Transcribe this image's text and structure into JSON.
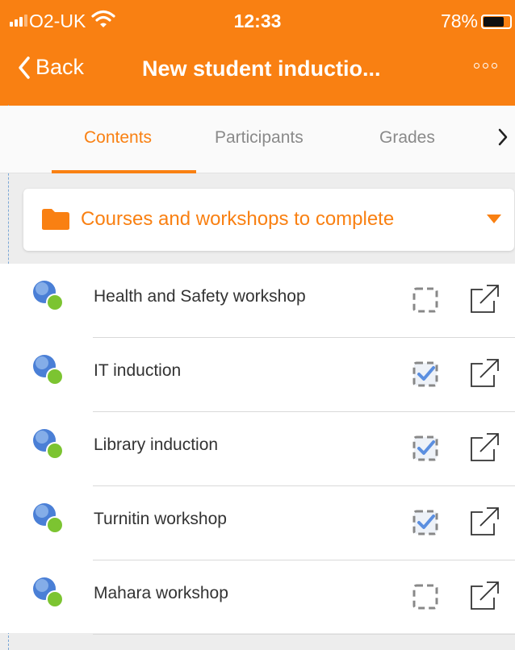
{
  "status_bar": {
    "carrier": "O2-UK",
    "time": "12:33",
    "battery_percent": "78%",
    "battery_level": 0.78
  },
  "nav": {
    "back_label": "Back",
    "title": "New student inductio...",
    "more_icon": "more-dots-icon"
  },
  "tabs": [
    {
      "label": "Contents",
      "active": true
    },
    {
      "label": "Participants",
      "active": false
    },
    {
      "label": "Grades",
      "active": false
    }
  ],
  "section": {
    "icon": "folder-icon",
    "title": "Courses and workshops to complete"
  },
  "activities": [
    {
      "name": "Health and Safety workshop",
      "completed": false
    },
    {
      "name": "IT induction",
      "completed": true
    },
    {
      "name": "Library induction",
      "completed": true
    },
    {
      "name": "Turnitin workshop",
      "completed": true
    },
    {
      "name": "Mahara workshop",
      "completed": false
    }
  ],
  "colors": {
    "accent": "#f98012",
    "check": "#5b8fe0",
    "module_blue": "#4a7fd6",
    "module_green": "#7cc431"
  }
}
